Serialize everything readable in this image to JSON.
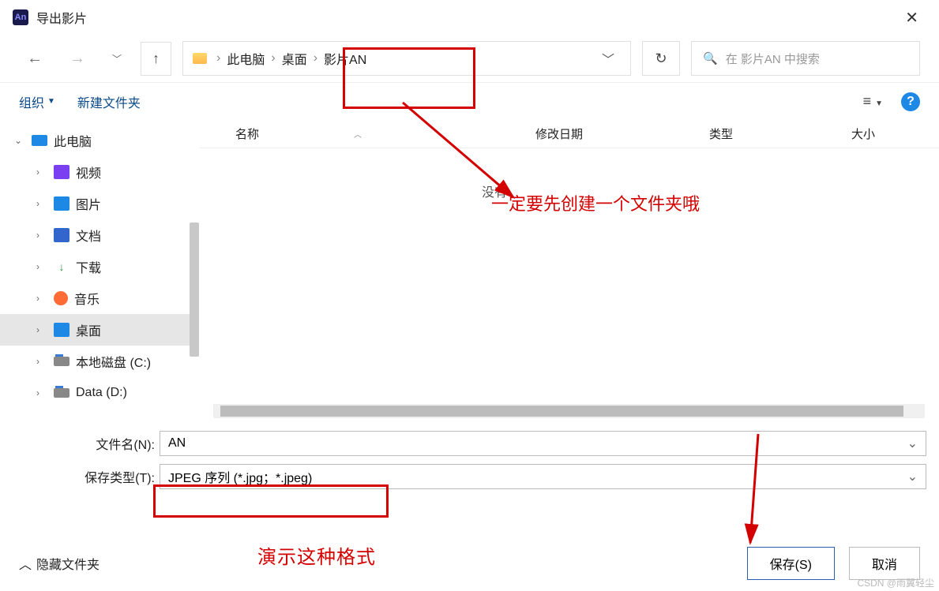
{
  "window": {
    "title": "导出影片",
    "app_abbr": "An"
  },
  "breadcrumb": {
    "pc": "此电脑",
    "desktop": "桌面",
    "folder": "影片AN"
  },
  "search": {
    "placeholder": "在 影片AN 中搜索"
  },
  "toolbar": {
    "organize": "组织",
    "new_folder": "新建文件夹"
  },
  "columns": {
    "name": "名称",
    "date": "修改日期",
    "type": "类型",
    "size": "大小"
  },
  "empty_hint": "没有",
  "tree": {
    "root": "此电脑",
    "items": [
      {
        "label": "视频"
      },
      {
        "label": "图片"
      },
      {
        "label": "文档"
      },
      {
        "label": "下载"
      },
      {
        "label": "音乐"
      },
      {
        "label": "桌面"
      },
      {
        "label": "本地磁盘 (C:)"
      },
      {
        "label": "Data (D:)"
      }
    ]
  },
  "form": {
    "filename_label": "文件名(N):",
    "filename_value": "AN",
    "type_label": "保存类型(T):",
    "type_value": "JPEG 序列 (*.jpg；*.jpeg)"
  },
  "footer": {
    "hide": "隐藏文件夹",
    "save": "保存(S)",
    "cancel": "取消"
  },
  "annotations": {
    "a1": "一定要先创建一个文件夹哦",
    "a2": "演示这种格式",
    "watermark": "CSDN @雨翼轻尘"
  }
}
